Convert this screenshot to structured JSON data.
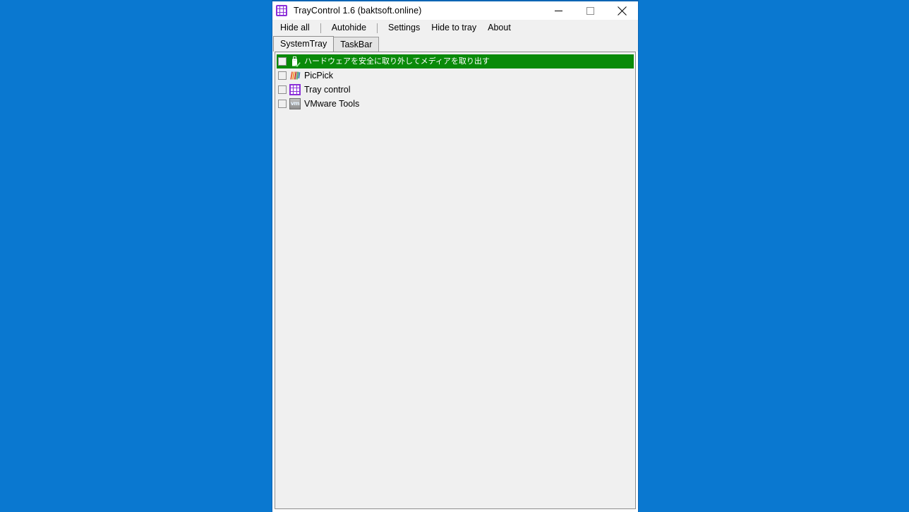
{
  "desktop": {
    "background_color": "#0a78d0"
  },
  "window": {
    "title": "TrayControl 1.6 (baktsoft.online)",
    "icon": "tray-grid-icon",
    "accent_color": "#8b2fd8",
    "border_color": "#0a64b4",
    "controls": {
      "minimize": "minimize-icon",
      "maximize": "maximize-icon",
      "close": "close-icon"
    }
  },
  "menubar": {
    "items": [
      {
        "label": "Hide all",
        "separator_after": true
      },
      {
        "label": "Autohide",
        "separator_after": true
      },
      {
        "label": "Settings",
        "separator_after": false
      },
      {
        "label": "Hide to tray",
        "separator_after": false
      },
      {
        "label": "About",
        "separator_after": false
      }
    ]
  },
  "tabs": [
    {
      "label": "SystemTray",
      "selected": true
    },
    {
      "label": "TaskBar",
      "selected": false
    }
  ],
  "list": {
    "highlight_color": "#098a09",
    "background_color": "#f0f0f0",
    "items": [
      {
        "label": "ハードウェアを安全に取り外してメディアを取り出す",
        "icon": "usb-drive-icon",
        "checked": false,
        "highlighted": true,
        "japanese": true
      },
      {
        "label": "PicPick",
        "icon": "picpick-icon",
        "checked": false,
        "highlighted": false,
        "japanese": false
      },
      {
        "label": "Tray control",
        "icon": "tray-grid-icon",
        "checked": false,
        "highlighted": false,
        "japanese": false
      },
      {
        "label": "VMware Tools",
        "icon": "vmware-icon",
        "icon_text": "vm",
        "checked": false,
        "highlighted": false,
        "japanese": false
      }
    ]
  }
}
